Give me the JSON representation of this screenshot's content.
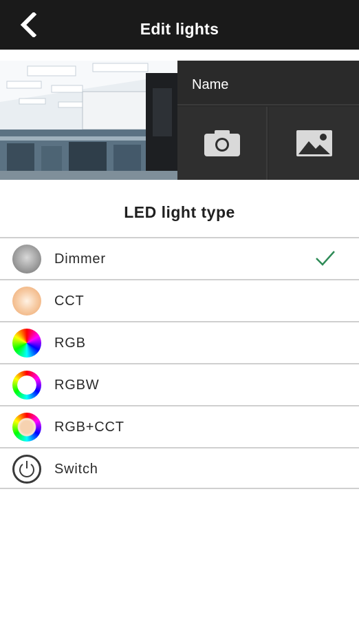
{
  "header": {
    "title": "Edit lights",
    "back_icon": "chevron-left-icon"
  },
  "profile": {
    "name_label": "Name",
    "camera_icon": "camera-icon",
    "gallery_icon": "image-icon"
  },
  "section": {
    "title": "LED light type"
  },
  "light_types": [
    {
      "label": "Dimmer",
      "icon": "dimmer-icon",
      "selected": true
    },
    {
      "label": "CCT",
      "icon": "cct-icon",
      "selected": false
    },
    {
      "label": "RGB",
      "icon": "rgb-icon",
      "selected": false
    },
    {
      "label": "RGBW",
      "icon": "rgbw-icon",
      "selected": false
    },
    {
      "label": "RGB+CCT",
      "icon": "rgb-cct-icon",
      "selected": false
    },
    {
      "label": "Switch",
      "icon": "power-icon",
      "selected": false
    }
  ],
  "colors": {
    "topbar": "#1a1a1a",
    "check": "#2e8b57",
    "divider": "#cfcfcf"
  }
}
